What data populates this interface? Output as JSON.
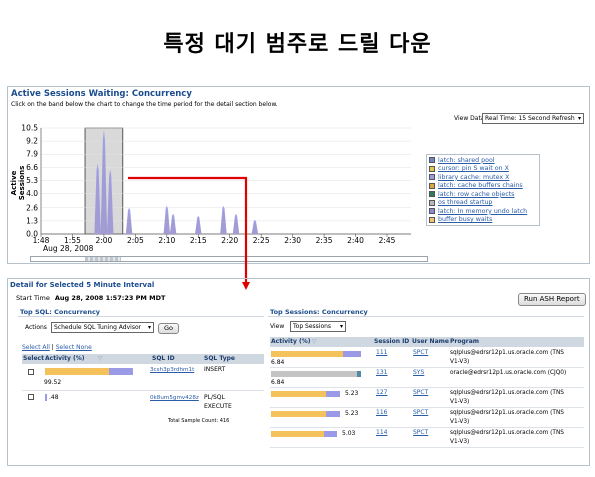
{
  "slide_title": "특정 대기 범주로 드릴 다운",
  "top_panel": {
    "title": "Active Sessions Waiting: Concurrency",
    "instruction": "Click on the band below the chart to change the time period for the detail section below.",
    "view_data_label": "View Data",
    "view_data_value": "Real Time: 15 Second Refresh",
    "y_axis_label": "Active Sessions"
  },
  "chart_data": {
    "type": "area",
    "ylabel": "Active Sessions",
    "xlabel": "",
    "ylim": [
      0,
      10.5
    ],
    "y_ticks": [
      "10.5",
      "9.2",
      "7.9",
      "6.6",
      "5.3",
      "4.0",
      "2.6",
      "1.3",
      "0.0"
    ],
    "x_ticks": [
      "1:48",
      "1:55",
      "2:00",
      "2:05",
      "2:10",
      "2:15",
      "2:20",
      "2:25",
      "2:30",
      "2:35",
      "2:40",
      "2:45"
    ],
    "x_date": "Aug 28, 2008",
    "series": [
      {
        "name": "latch: shared pool",
        "color": "#6f84c2"
      },
      {
        "name": "cursor: pin S wait on X",
        "color": "#e0c84a"
      },
      {
        "name": "library cache: mutex X",
        "color": "#9a9adf"
      },
      {
        "name": "latch: cache buffers chains",
        "color": "#d9a640"
      },
      {
        "name": "latch: row cache objects",
        "color": "#2f7a5a"
      },
      {
        "name": "os thread startup",
        "color": "#b9b9b9"
      },
      {
        "name": "latch: In memory undo latch",
        "color": "#8a8ad6"
      },
      {
        "name": "buffer busy waits",
        "color": "#f0c470"
      }
    ],
    "peaks": [
      {
        "x": "1:59",
        "y": 7.0
      },
      {
        "x": "2:00",
        "y": 10.3
      },
      {
        "x": "2:01",
        "y": 6.4
      },
      {
        "x": "2:04",
        "y": 2.6
      },
      {
        "x": "2:10",
        "y": 2.8
      },
      {
        "x": "2:11",
        "y": 2.0
      },
      {
        "x": "2:15",
        "y": 1.8
      },
      {
        "x": "2:19",
        "y": 2.8
      },
      {
        "x": "2:21",
        "y": 2.0
      },
      {
        "x": "2:24",
        "y": 1.4
      }
    ]
  },
  "detail": {
    "title": "Detail for Selected 5 Minute Interval",
    "start_time_label": "Start Time",
    "start_time_value": "Aug 28, 2008 1:57:23 PM MDT",
    "run_ash_label": "Run ASH Report"
  },
  "top_sql": {
    "title": "Top SQL: Concurrency",
    "actions_label": "Actions",
    "actions_value": "Schedule SQL Tuning Advisor",
    "go_label": "Go",
    "select_all": "Select All",
    "select_none": "Select None",
    "headers": [
      "Select",
      "Activity (%)",
      "SQL ID",
      "SQL Type"
    ],
    "rows": [
      {
        "activity": "99.52",
        "sql_id": "3csh3p3rdhm1t",
        "sql_type": "INSERT",
        "fraction": 0.9952
      },
      {
        "activity": ".48",
        "sql_id": "0k8um5gmv428z",
        "sql_type_line1": "PL/SQL",
        "sql_type_line2": "EXECUTE",
        "fraction": 0.0048
      }
    ],
    "total": "Total Sample Count: 416"
  },
  "top_sessions": {
    "title": "Top Sessions: Concurrency",
    "view_label": "View",
    "view_value": "Top Sessions",
    "headers": [
      "Activity (%)",
      "Session ID",
      "User Name",
      "Program"
    ],
    "rows": [
      {
        "activity": "6.84",
        "sid": "111",
        "user": "SPCT",
        "prog1": "sqlplus@edrsr12p1.us.oracle.com (TNS",
        "prog2": "V1-V3)",
        "fraction": 0.0684
      },
      {
        "activity": "6.84",
        "sid": "131",
        "user": "SYS",
        "prog1": "oracle@edrsr12p1.us.oracle.com (CJQ0)",
        "prog2": "",
        "fraction": 0.0684
      },
      {
        "activity": "5.23",
        "sid": "127",
        "user": "SPCT",
        "prog1": "sqlplus@edrsr12p1.us.oracle.com (TNS",
        "prog2": "V1-V3)",
        "fraction": 0.0523
      },
      {
        "activity": "5.23",
        "sid": "116",
        "user": "SPCT",
        "prog1": "sqlplus@edrsr12p1.us.oracle.com (TNS",
        "prog2": "V1-V3)",
        "fraction": 0.0523
      },
      {
        "activity": "5.03",
        "sid": "114",
        "user": "SPCT",
        "prog1": "sqlplus@edrsr12p1.us.oracle.com (TNS",
        "prog2": "V1-V3)",
        "fraction": 0.0503
      }
    ]
  },
  "colors": {
    "accent_blue": "#1b4c8e",
    "drill_arrow": "#e00000",
    "bar_yellow": "#f5c15a",
    "bar_purple": "#9a9ae6",
    "bar_grey": "#c4c4c4",
    "bar_teal": "#4f8aa7"
  }
}
